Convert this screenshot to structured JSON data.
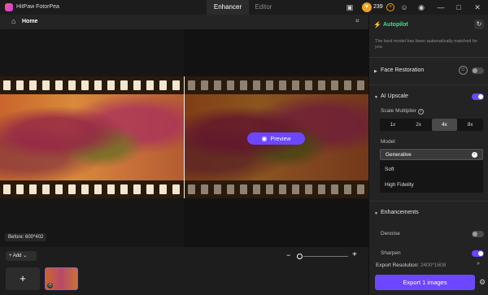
{
  "app": {
    "title": "HitPaw FotorPea"
  },
  "tabs": [
    {
      "label": "Enhancer"
    },
    {
      "label": "Editor"
    }
  ],
  "credits": {
    "count": "239"
  },
  "nav": {
    "home_label": "Home"
  },
  "canvas": {
    "preview_label": "Preview",
    "before_label": "Before: 600*402"
  },
  "bottom": {
    "add_label": "+ Add"
  },
  "panel": {
    "autopilot_label": "Autopilot",
    "autopilot_desc": "The best model has been automatically matched for you",
    "face_restoration_label": "Face Restoration",
    "face_restoration_on": false,
    "ai_upscale_label": "AI Upscale",
    "ai_upscale_on": true,
    "scale_multiplier_label": "Scale Multiplier",
    "scale_options": [
      "1x",
      "2x",
      "4x",
      "8x"
    ],
    "scale_selected": "4x",
    "model_label": "Model",
    "models": [
      "Generative",
      "Soft",
      "High Fidelity"
    ],
    "model_selected": "Generative",
    "enhancements_label": "Enhancements",
    "denoise_label": "Denoise",
    "denoise_on": false,
    "sharpen_label": "Sharpen",
    "sharpen_on": true,
    "export_resolution_label": "Export Resolution:",
    "export_resolution_value": "2400*1608",
    "export_button_label": "Export 1 images"
  },
  "colors": {
    "accent": "#6c47ff",
    "autopilot": "#3ee38a",
    "coin": "#f0a020"
  },
  "icons": {
    "home": "home-icon",
    "crop": "crop-icon",
    "bolt": "bolt-icon",
    "refresh": "refresh-icon",
    "settings": "gear-icon",
    "eye": "eye-icon"
  }
}
